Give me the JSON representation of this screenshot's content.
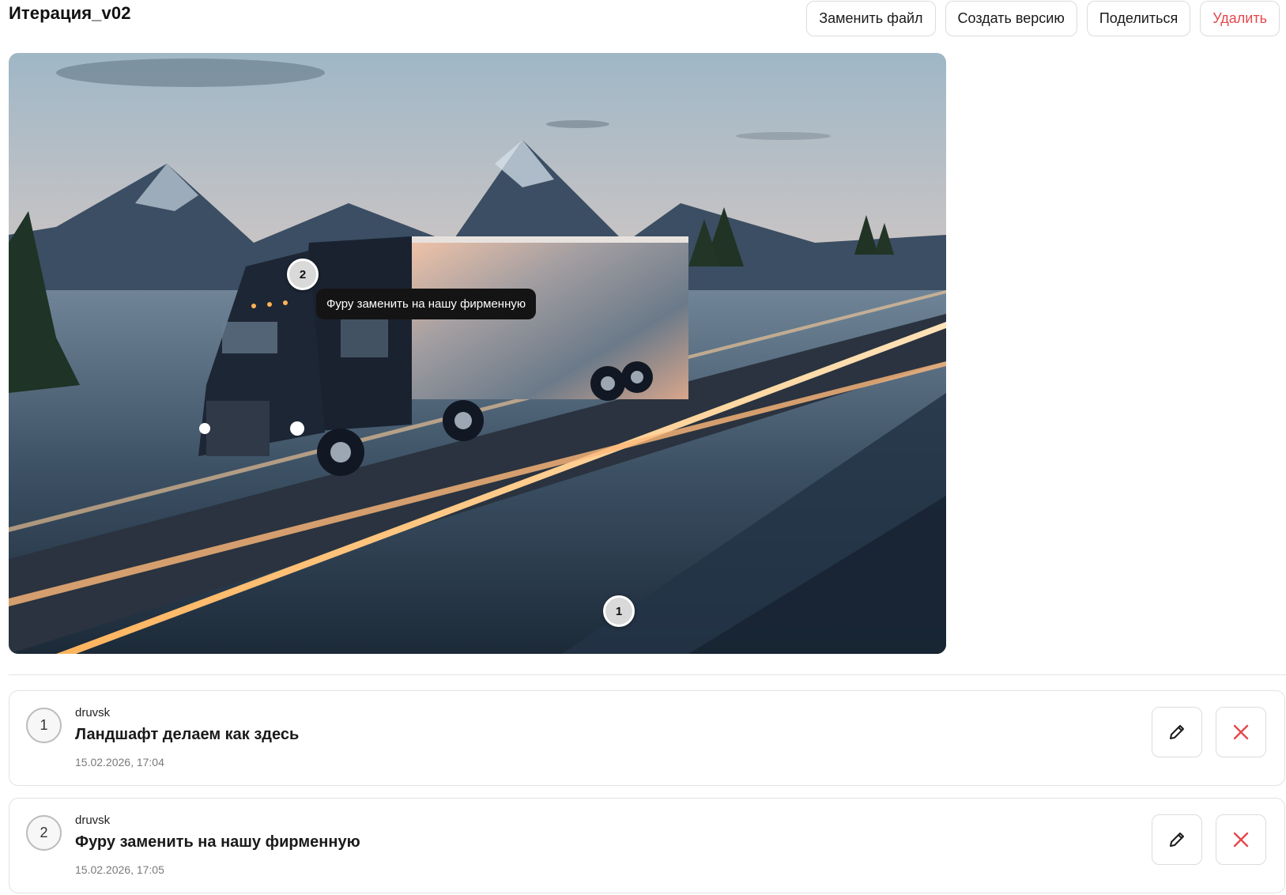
{
  "header": {
    "title": "Итерация_v02",
    "buttons": {
      "replace_file": "Заменить файл",
      "create_version": "Создать версию",
      "share": "Поделиться",
      "delete": "Удалить"
    }
  },
  "preview": {
    "markers": [
      {
        "number": "1"
      },
      {
        "number": "2",
        "tooltip": "Фуру заменить на нашу фирменную"
      }
    ]
  },
  "comments": [
    {
      "number": "1",
      "author": "druvsk",
      "text": "Ландшафт делаем как здесь",
      "date": "15.02.2026, 17:04"
    },
    {
      "number": "2",
      "author": "druvsk",
      "text": "Фуру заменить на нашу фирменную",
      "date": "15.02.2026, 17:05"
    }
  ],
  "colors": {
    "danger": "#e5484d",
    "tooltip_bg": "#141414",
    "marker_bg": "#d9d9d9"
  },
  "icons": {
    "edit": "pencil-icon",
    "delete": "close-icon"
  }
}
